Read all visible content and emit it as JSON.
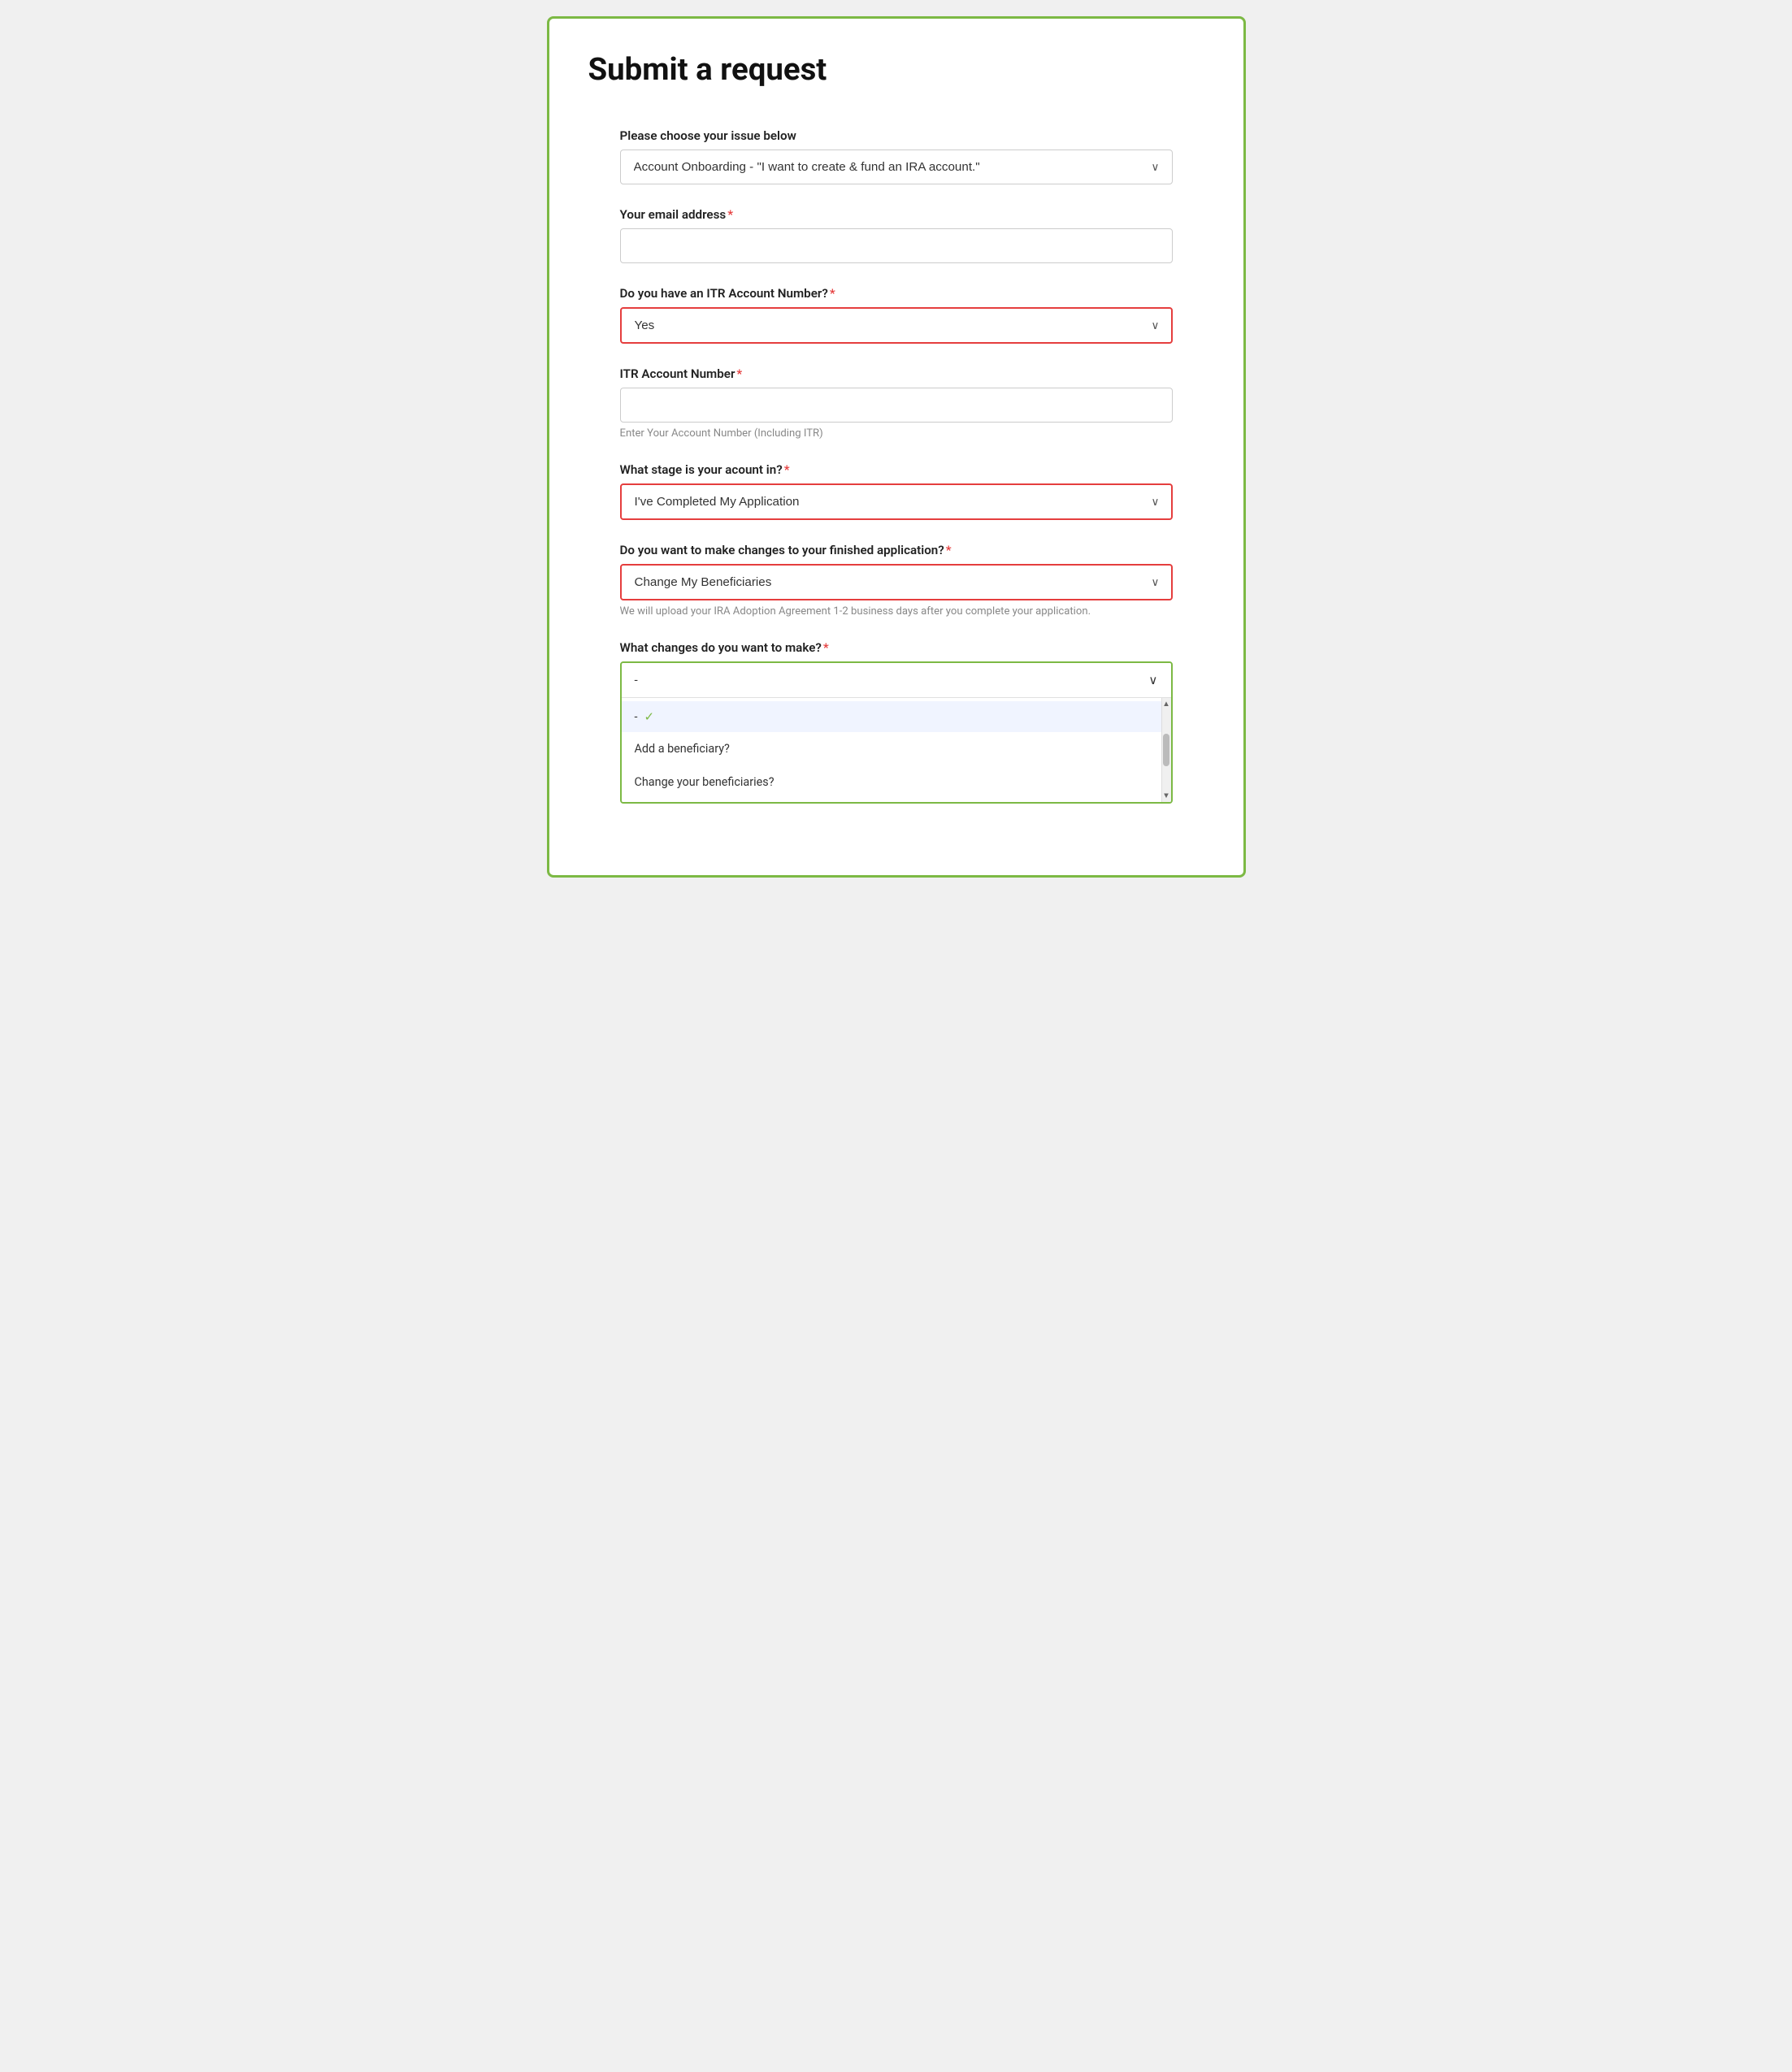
{
  "page": {
    "title": "Submit a request",
    "border_color": "#7cb944"
  },
  "form": {
    "issue_label": "Please choose your issue below",
    "issue_value": "Account Onboarding - \"I want to create & fund an IRA account.\"",
    "issue_placeholder": "Account Onboarding - \"I want to create & fund an IRA account.\"",
    "email_label": "Your email address",
    "email_required": "*",
    "itr_question_label": "Do you have an ITR Account Number?",
    "itr_question_required": "*",
    "itr_question_value": "Yes",
    "itr_account_label": "ITR Account Number",
    "itr_account_required": "*",
    "itr_account_placeholder": "Enter Your Account Number (Including ITR)",
    "stage_label": "What stage is your acount in?",
    "stage_required": "*",
    "stage_value": "I've Completed My Application",
    "changes_label": "Do you want to make changes to your finished application?",
    "changes_required": "*",
    "changes_value": "Change My Beneficiaries",
    "changes_hint": "We will upload your IRA Adoption Agreement 1-2 business days after you complete your application.",
    "what_changes_label": "What changes do you want to make?",
    "what_changes_required": "*",
    "what_changes_placeholder": "-",
    "dropdown_selected_item": "-",
    "dropdown_items": [
      {
        "label": "Add a beneficiary?",
        "selected": false
      },
      {
        "label": "Change your beneficiaries?",
        "selected": false
      }
    ]
  }
}
